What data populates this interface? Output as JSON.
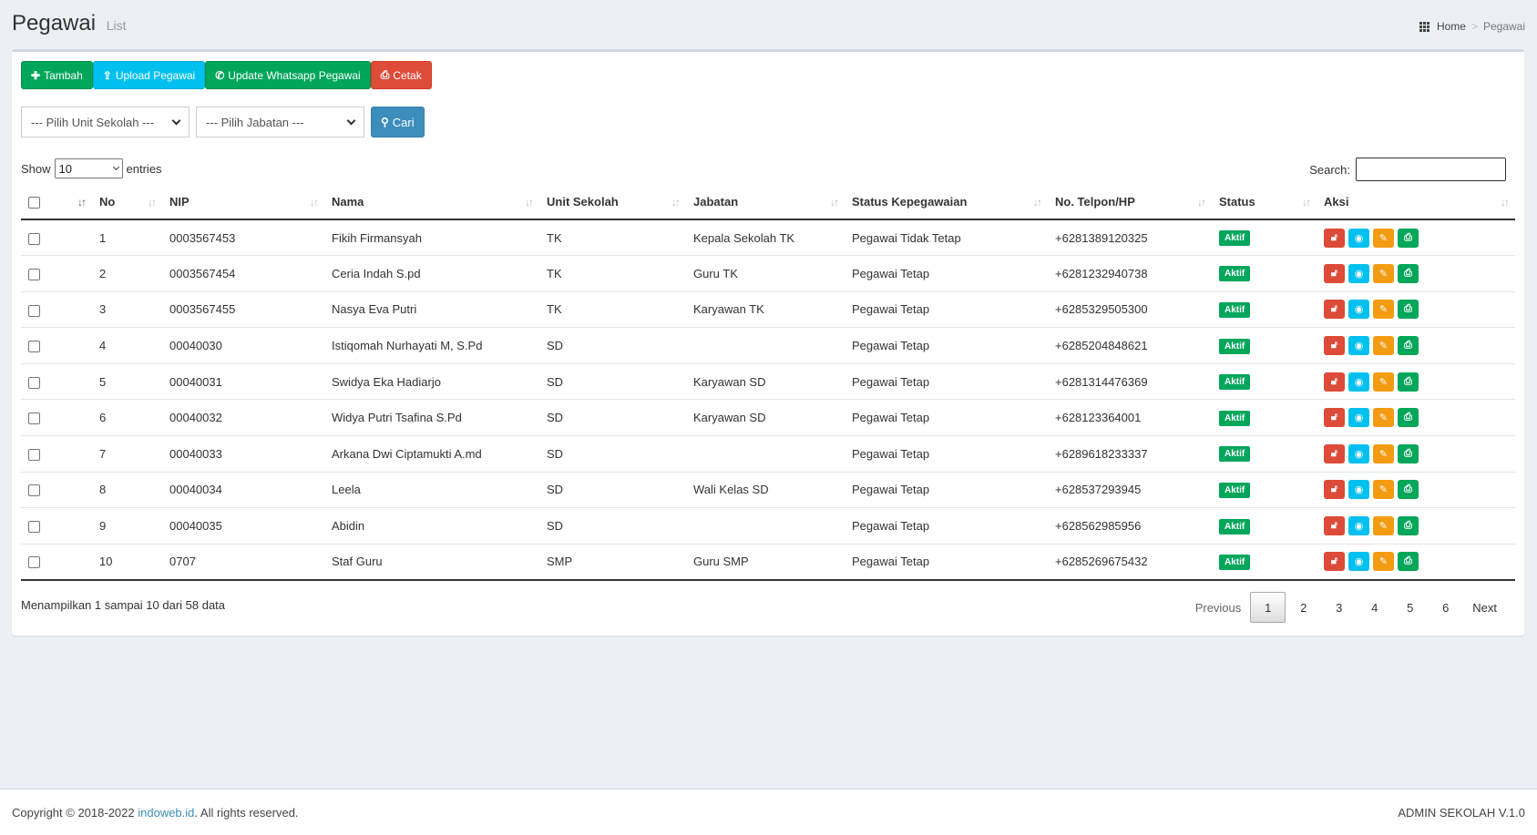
{
  "header": {
    "title": "Pegawai",
    "subtitle": "List"
  },
  "breadcrumb": {
    "home": "Home",
    "current": "Pegawai"
  },
  "toolbar": {
    "add_label": "Tambah",
    "upload_label": "Upload Pegawai",
    "whatsapp_label": "Update Whatsapp Pegawai",
    "print_label": "Cetak"
  },
  "filters": {
    "unit_placeholder": "--- Pilih Unit Sekolah ---",
    "jabatan_placeholder": "--- Pilih Jabatan ---",
    "search_button": "Cari"
  },
  "table_controls": {
    "show_label": "Show",
    "show_value": "10",
    "entries_label": "entries",
    "search_label": "Search:"
  },
  "columns": [
    "No",
    "NIP",
    "Nama",
    "Unit Sekolah",
    "Jabatan",
    "Status Kepegawaian",
    "No. Telpon/HP",
    "Status",
    "Aksi"
  ],
  "rows": [
    {
      "no": "1",
      "nip": "0003567453",
      "nama": "Fikih Firmansyah",
      "unit": "TK",
      "jabatan": "Kepala Sekolah TK",
      "status_kep": "Pegawai Tidak Tetap",
      "telp": "+6281389120325",
      "status": "Aktif"
    },
    {
      "no": "2",
      "nip": "0003567454",
      "nama": "Ceria Indah S.pd",
      "unit": "TK",
      "jabatan": "Guru TK",
      "status_kep": "Pegawai Tetap",
      "telp": "+6281232940738",
      "status": "Aktif"
    },
    {
      "no": "3",
      "nip": "0003567455",
      "nama": "Nasya Eva Putri",
      "unit": "TK",
      "jabatan": "Karyawan TK",
      "status_kep": "Pegawai Tetap",
      "telp": "+6285329505300",
      "status": "Aktif"
    },
    {
      "no": "4",
      "nip": "00040030",
      "nama": "Istiqomah Nurhayati M, S.Pd",
      "unit": "SD",
      "jabatan": "",
      "status_kep": "Pegawai Tetap",
      "telp": "+6285204848621",
      "status": "Aktif"
    },
    {
      "no": "5",
      "nip": "00040031",
      "nama": "Swidya Eka Hadiarjo",
      "unit": "SD",
      "jabatan": "Karyawan SD",
      "status_kep": "Pegawai Tetap",
      "telp": "+6281314476369",
      "status": "Aktif"
    },
    {
      "no": "6",
      "nip": "00040032",
      "nama": "Widya Putri Tsafina S.Pd",
      "unit": "SD",
      "jabatan": "Karyawan SD",
      "status_kep": "Pegawai Tetap",
      "telp": "+628123364001",
      "status": "Aktif"
    },
    {
      "no": "7",
      "nip": "00040033",
      "nama": "Arkana Dwi Ciptamukti A.md",
      "unit": "SD",
      "jabatan": "",
      "status_kep": "Pegawai Tetap",
      "telp": "+6289618233337",
      "status": "Aktif"
    },
    {
      "no": "8",
      "nip": "00040034",
      "nama": "Leela",
      "unit": "SD",
      "jabatan": "Wali Kelas SD",
      "status_kep": "Pegawai Tetap",
      "telp": "+628537293945",
      "status": "Aktif"
    },
    {
      "no": "9",
      "nip": "00040035",
      "nama": "Abidin",
      "unit": "SD",
      "jabatan": "",
      "status_kep": "Pegawai Tetap",
      "telp": "+628562985956",
      "status": "Aktif"
    },
    {
      "no": "10",
      "nip": "0707",
      "nama": "Staf Guru",
      "unit": "SMP",
      "jabatan": "Guru SMP",
      "status_kep": "Pegawai Tetap",
      "telp": "+6285269675432",
      "status": "Aktif"
    }
  ],
  "table_info": "Menampilkan 1 sampai 10 dari 58 data",
  "pagination": {
    "previous": "Previous",
    "pages": [
      "1",
      "2",
      "3",
      "4",
      "5",
      "6"
    ],
    "next": "Next",
    "current": "1"
  },
  "footer": {
    "copyright_prefix": "Copyright © 2018-2022 ",
    "link_text": "indoweb.id",
    "copyright_suffix": ". All rights reserved.",
    "version": "ADMIN SEKOLAH V.1.0"
  },
  "colors": {
    "green": "#00a65a",
    "aqua": "#00c0ef",
    "red": "#dd4b39",
    "orange": "#f39c12",
    "blue": "#3c8dbc"
  }
}
